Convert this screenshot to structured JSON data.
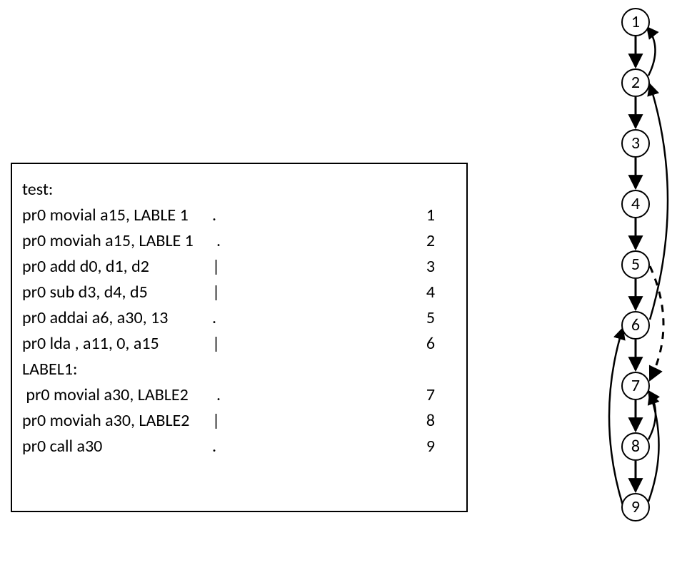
{
  "code": {
    "title": "test:",
    "lines": [
      {
        "asm": "pr0 movial a15, LABLE 1",
        "delim": ".",
        "num": "1",
        "pad_asm": 260,
        "pad_delim": 290
      },
      {
        "asm": "pr0 moviah a15, LABLE 1",
        "delim": ".",
        "num": "2",
        "pad_asm": 266,
        "pad_delim": 272
      },
      {
        "asm": "pr0 add d0, d1, d2",
        "delim": "|",
        "num": "3",
        "pad_asm": 196,
        "pad_delim": 280
      },
      {
        "asm": "pr0 sub d3, d4, d5",
        "delim": "|",
        "num": "4",
        "pad_asm": 196,
        "pad_delim": 280
      },
      {
        "asm": "pr0 addai a6, a30, 13",
        "delim": ".",
        "num": "5",
        "pad_asm": 218,
        "pad_delim": 286
      },
      {
        "asm": "pr0 lda , a11, 0, a15",
        "delim": "|",
        "num": "6",
        "pad_asm": 208,
        "pad_delim": 280
      }
    ],
    "label1": "LABEL1:",
    "lines2_indent": "  ",
    "lines2": [
      {
        "asm": " pr0 movial a30, LABLE2",
        "delim": ".",
        "num": "7",
        "pad_asm": 258,
        "pad_delim": 292
      },
      {
        "asm": "pr0 moviah a30, LABLE2",
        "delim": "|",
        "num": "8",
        "pad_asm": 254,
        "pad_delim": 264
      },
      {
        "asm": "pr0 call a30",
        "delim": ".",
        "num": "9",
        "pad_asm": 136,
        "pad_delim": 294
      }
    ]
  },
  "graph": {
    "nodes": [
      "1",
      "2",
      "3",
      "4",
      "5",
      "6",
      "7",
      "8",
      "9"
    ]
  },
  "chart_data": {
    "type": "diagram",
    "description": "Control-flow / dependency graph over instruction lines 1..9",
    "nodes": [
      1,
      2,
      3,
      4,
      5,
      6,
      7,
      8,
      9
    ],
    "sequential_edges": [
      [
        1,
        2
      ],
      [
        2,
        3
      ],
      [
        3,
        4
      ],
      [
        4,
        5
      ],
      [
        5,
        6
      ],
      [
        6,
        7
      ],
      [
        7,
        8
      ],
      [
        8,
        9
      ]
    ],
    "back_edges": [
      [
        2,
        1
      ],
      [
        6,
        2
      ],
      [
        9,
        6
      ],
      [
        9,
        7
      ],
      [
        8,
        7
      ]
    ],
    "dashed_edges": [
      [
        5,
        7
      ]
    ]
  }
}
